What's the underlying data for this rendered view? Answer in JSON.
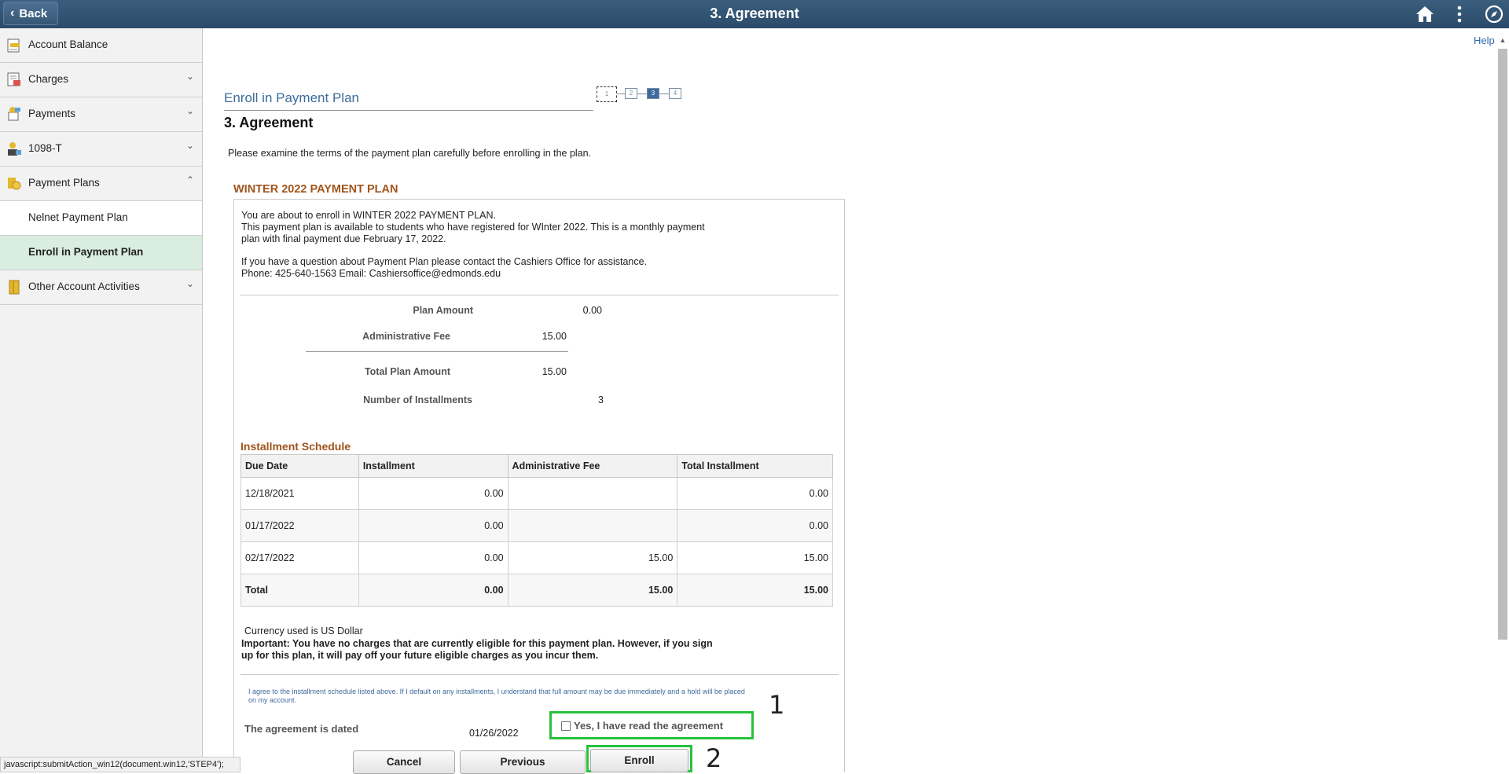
{
  "header": {
    "back_label": "Back",
    "title": "3. Agreement",
    "help": "Help"
  },
  "sidebar": {
    "items": [
      {
        "label": "Account Balance"
      },
      {
        "label": "Charges"
      },
      {
        "label": "Payments"
      },
      {
        "label": "1098-T"
      },
      {
        "label": "Payment Plans"
      },
      {
        "label": "Nelnet Payment Plan"
      },
      {
        "label": "Enroll in Payment Plan"
      },
      {
        "label": "Other Account Activities"
      }
    ]
  },
  "main": {
    "section_title": "Enroll in Payment Plan",
    "page_heading": "3. Agreement",
    "intro": "Please examine the terms of the payment plan carefully before enrolling in the plan.",
    "steps": [
      "1",
      "2",
      "3",
      "4"
    ],
    "plan": {
      "title": "WINTER 2022 PAYMENT PLAN",
      "desc1": "You are about to enroll in WINTER 2022 PAYMENT PLAN.",
      "desc2": "This payment plan is available to students who have registered for WInter 2022.  This is a monthly payment",
      "desc3": "plan with final payment due February 17, 2022.",
      "desc4": "If you have a question about Payment Plan please contact the Cashiers Office for assistance.",
      "desc5": "Phone: 425-640-1563 Email: Cashiersoffice@edmonds.edu",
      "plan_amount_label": "Plan Amount",
      "plan_amount": "0.00",
      "admin_fee_label": "Administrative Fee",
      "admin_fee": "15.00",
      "total_label": "Total Plan Amount",
      "total": "15.00",
      "installments_label": "Number of Installments",
      "installments": "3"
    },
    "schedule": {
      "title": "Installment Schedule",
      "headers": [
        "Due Date",
        "Installment",
        "Administrative Fee",
        "Total Installment"
      ],
      "rows": [
        [
          "12/18/2021",
          "0.00",
          "",
          "0.00"
        ],
        [
          "01/17/2022",
          "0.00",
          "",
          "0.00"
        ],
        [
          "02/17/2022",
          "0.00",
          "15.00",
          "15.00"
        ],
        [
          "Total",
          "0.00",
          "15.00",
          "15.00"
        ]
      ]
    },
    "currency": "Currency used is US Dollar",
    "important1": "Important:  You have no charges that are currently eligible for this payment plan.   However, if you sign",
    "important2": "up for this plan, it will pay off your future eligible charges as you incur them.",
    "agree_text1": "I agree to the installment schedule listed above.  If I default on any installments, I understand that full amount may be due immediately and a hold will be placed",
    "agree_text2": "on my account.",
    "dated_label": "The agreement is dated",
    "dated_value": "01/26/2022",
    "checkbox_label": "Yes, I have read the agreement",
    "marker1": "1",
    "marker2": "2",
    "buttons": {
      "cancel": "Cancel",
      "previous": "Previous",
      "enroll": "Enroll"
    }
  },
  "status_bar": "javascript:submitAction_win12(document.win12,'STEP4');",
  "colors": {
    "accent_green": "#29c23a",
    "header_bg": "#2f506e",
    "section_orange": "#a0541c"
  }
}
